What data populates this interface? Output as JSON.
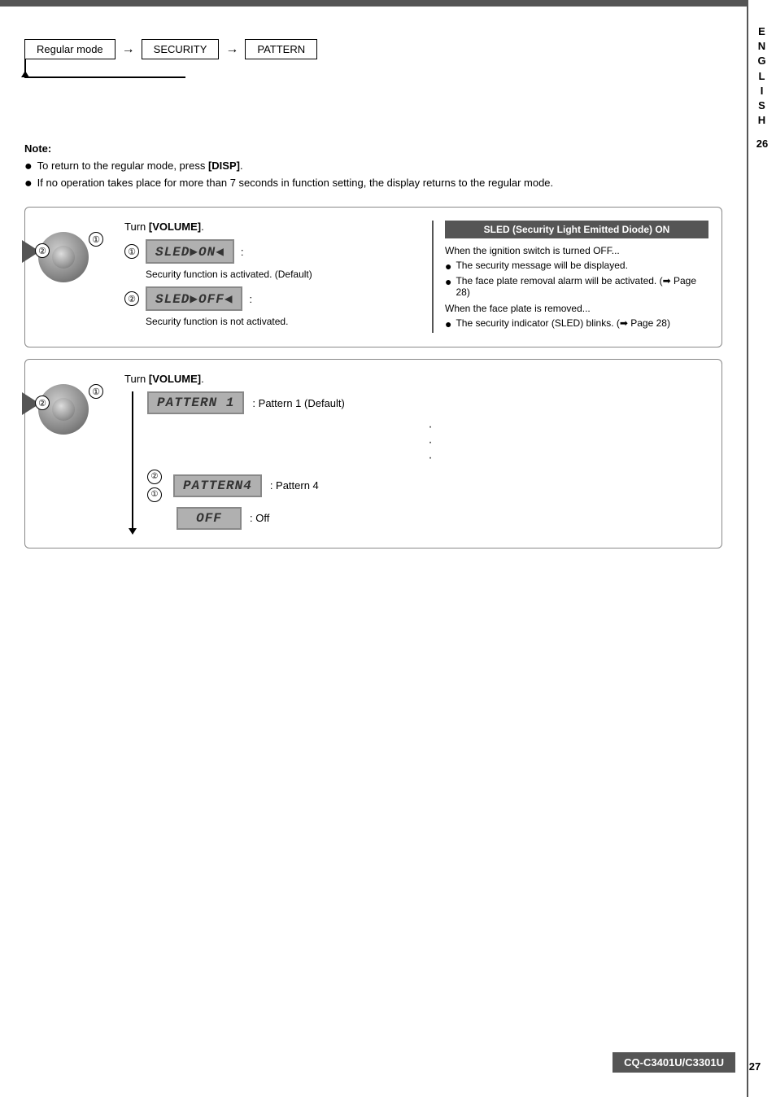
{
  "page": {
    "page_number": "27",
    "sidebar_letters": [
      "E",
      "N",
      "G",
      "L",
      "I",
      "S",
      "H"
    ],
    "sidebar_page": "26",
    "model_number": "CQ-C3401U/C3301U"
  },
  "flow": {
    "regular_mode": "Regular mode",
    "security": "SECURITY",
    "pattern": "PATTERN"
  },
  "note": {
    "title": "Note:",
    "items": [
      "To return to the regular mode, press [DISP].",
      "If no operation takes place for more than 7 seconds in function setting, the display returns to the regular mode."
    ],
    "disp_bold": "[DISP]"
  },
  "sled_section": {
    "instruction": "Turn [VOLUME].",
    "volume_bold": "[VOLUME]",
    "option1_display": "SLED ON",
    "option1_desc": "Security function is activated. (Default)",
    "option2_display": "SLED OFF",
    "option2_desc": "Security function is not activated.",
    "sled_box": {
      "title": "SLED (Security Light Emitted Diode) ON",
      "ignition_off_label": "When the ignition switch is turned OFF...",
      "ignition_items": [
        "The security message will be displayed.",
        "The face plate removal alarm will be activated. (➡ Page 28)"
      ],
      "face_plate_label": "When the face plate is removed...",
      "face_plate_items": [
        "The security indicator (SLED) blinks. (➡ Page 28)"
      ]
    }
  },
  "pattern_section": {
    "instruction": "Turn [VOLUME].",
    "volume_bold": "[VOLUME]",
    "pattern1_display": "PATTERN 1",
    "pattern1_desc": ": Pattern 1 (Default)",
    "pattern4_display": "PATTERN4",
    "pattern4_desc": ": Pattern 4",
    "off_display": "OFF",
    "off_desc": ": Off"
  }
}
